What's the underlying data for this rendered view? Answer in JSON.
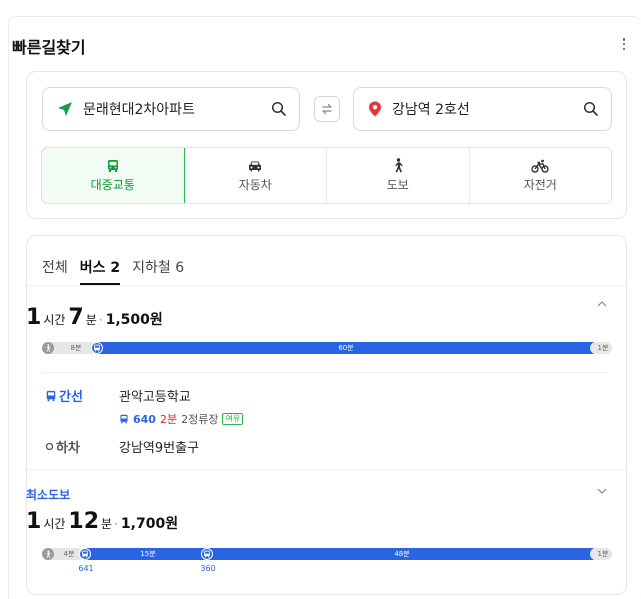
{
  "panel": {
    "title": "빠른길찾기"
  },
  "search": {
    "start": "문래현대2차아파트",
    "end": "강남역 2호선"
  },
  "modes": [
    {
      "label": "대중교통",
      "icon": "bus-icon",
      "active": true
    },
    {
      "label": "자동차",
      "icon": "car-icon",
      "active": false
    },
    {
      "label": "도보",
      "icon": "walk-icon",
      "active": false
    },
    {
      "label": "자전거",
      "icon": "bicycle-icon",
      "active": false
    }
  ],
  "filter_tabs": [
    {
      "label": "전체",
      "active": false
    },
    {
      "label": "버스 2",
      "active": true
    },
    {
      "label": "지하철 6",
      "active": false
    }
  ],
  "routes": [
    {
      "tag": "",
      "hours": "1",
      "hours_unit": "시간",
      "minutes": "7",
      "minutes_unit": "분",
      "fare": "1,500원",
      "expanded": true,
      "segments": [
        {
          "type": "walk",
          "label": "8분",
          "minutes": 8
        },
        {
          "type": "bus",
          "label": "60분",
          "minutes": 60,
          "number": ""
        },
        {
          "type": "walk",
          "label": "1분",
          "minutes": 1
        }
      ],
      "steps": {
        "board_label": "간선",
        "board_stop": "관악고등학교",
        "bus_number": "640",
        "bus_wait": "2분",
        "bus_stops": "2정류장",
        "bus_badge": "여유",
        "alight_label": "하차",
        "alight_stop": "강남역9번출구"
      }
    },
    {
      "tag": "최소도보",
      "hours": "1",
      "hours_unit": "시간",
      "minutes": "12",
      "minutes_unit": "분",
      "fare": "1,700원",
      "expanded": false,
      "segments": [
        {
          "type": "walk",
          "label": "4분",
          "minutes": 4
        },
        {
          "type": "bus",
          "label": "15분",
          "minutes": 15,
          "number": "641"
        },
        {
          "type": "bus",
          "label": "48분",
          "minutes": 48,
          "number": "360"
        },
        {
          "type": "walk",
          "label": "1분",
          "minutes": 1
        }
      ]
    }
  ],
  "colors": {
    "accent_green": "#2bb44f",
    "bus_blue": "#2b64e3",
    "wait_red": "#e6252c"
  }
}
